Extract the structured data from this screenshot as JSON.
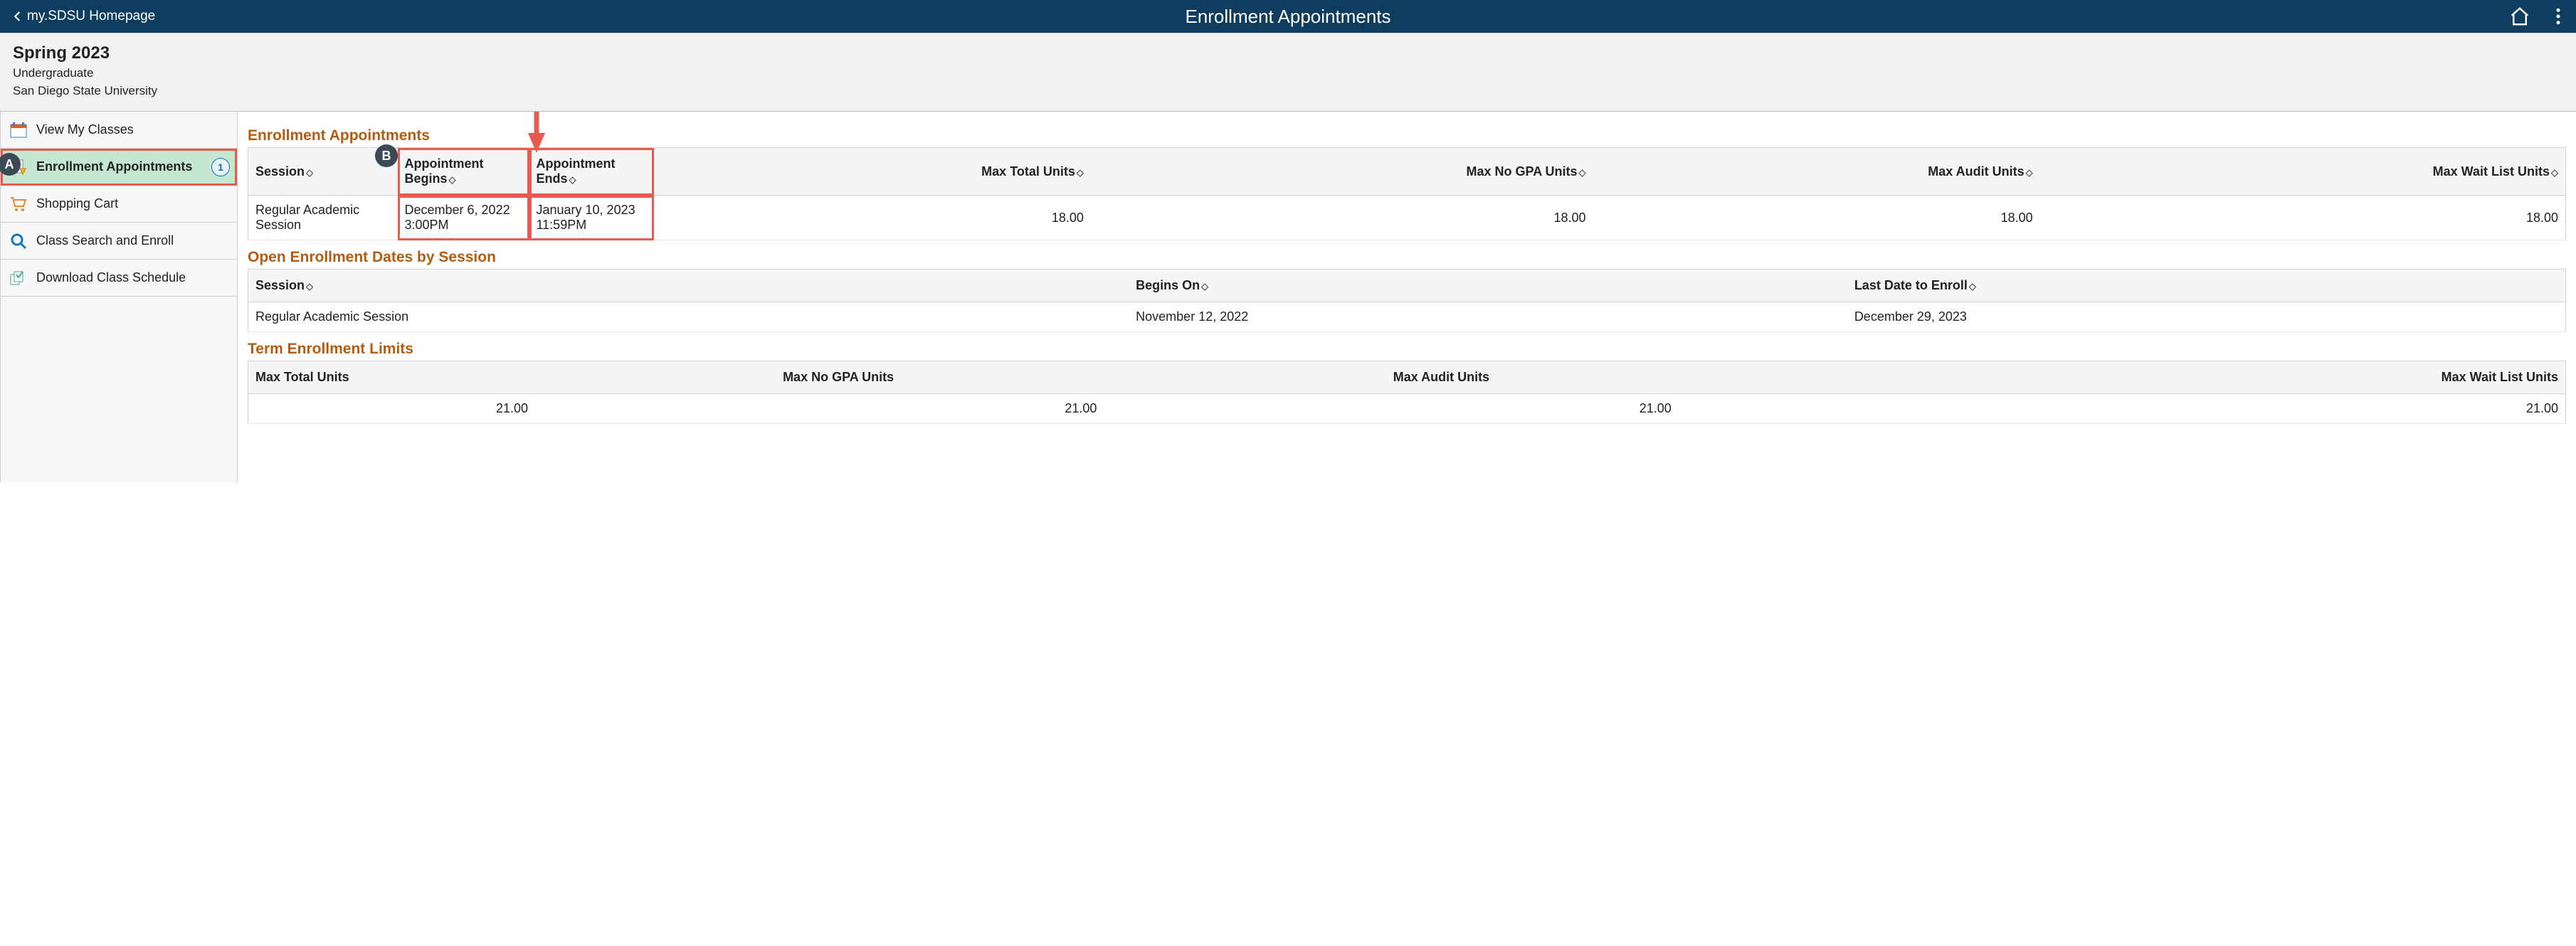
{
  "topbar": {
    "back_label": "my.SDSU Homepage",
    "title": "Enrollment Appointments"
  },
  "context": {
    "term": "Spring 2023",
    "career": "Undergraduate",
    "institution": "San Diego State University"
  },
  "sidebar": {
    "items": [
      {
        "label": "View My Classes"
      },
      {
        "label": "Enrollment Appointments",
        "badge": "1",
        "active": true
      },
      {
        "label": "Shopping Cart"
      },
      {
        "label": "Class Search and Enroll"
      },
      {
        "label": "Download Class Schedule"
      }
    ]
  },
  "sections": {
    "enroll_appts": {
      "title": "Enrollment Appointments",
      "headers": [
        "Session",
        "Appointment Begins",
        "Appointment Ends",
        "Max Total Units",
        "Max No GPA Units",
        "Max Audit Units",
        "Max Wait List Units"
      ],
      "row": {
        "session": "Regular Academic Session",
        "begins_date": "December 6, 2022",
        "begins_time": "3:00PM",
        "ends_date": "January 10, 2023",
        "ends_time": "11:59PM",
        "max_total": "18.00",
        "max_nogpa": "18.00",
        "max_audit": "18.00",
        "max_wait": "18.00"
      }
    },
    "open_enroll": {
      "title": "Open Enrollment Dates by Session",
      "headers": [
        "Session",
        "Begins On",
        "Last Date to Enroll"
      ],
      "row": {
        "session": "Regular Academic Session",
        "begins": "November 12, 2022",
        "last": "December 29, 2023"
      }
    },
    "limits": {
      "title": "Term Enrollment Limits",
      "headers": [
        "Max Total Units",
        "Max No GPA Units",
        "Max Audit Units",
        "Max Wait List Units"
      ],
      "row": {
        "c1": "21.00",
        "c2": "21.00",
        "c3": "21.00",
        "c4": "21.00"
      }
    }
  },
  "annotations": {
    "a": "A",
    "b": "B"
  }
}
